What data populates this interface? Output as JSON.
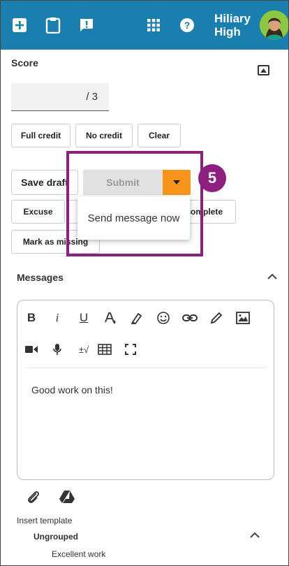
{
  "topbar": {
    "color": "#1a7fae",
    "icons": [
      "add-icon",
      "clipboard-icon",
      "feedback-icon",
      "apps-grid-icon",
      "help-icon"
    ],
    "user_name": "Hiliary High"
  },
  "score": {
    "label": "Score",
    "value": "",
    "suffix": "/ 3",
    "buttons": {
      "full_credit": "Full credit",
      "no_credit": "No credit",
      "clear": "Clear"
    }
  },
  "actions": {
    "save_draft": "Save draft",
    "submit": "Submit",
    "excuse": "Excuse",
    "complete_partial": "complete",
    "mark_missing": "Mark as missing"
  },
  "dropdown": {
    "send_now": "Send message now"
  },
  "callout": {
    "step": "5",
    "color": "#8c1f80"
  },
  "messages": {
    "label": "Messages",
    "editor_body": "Good work on this!",
    "toolbar_row1": [
      "bold-icon",
      "italic-icon",
      "underline-icon",
      "text-color-icon",
      "highlight-icon",
      "emoji-icon",
      "link-icon",
      "pencil-icon",
      "image-icon"
    ],
    "toolbar_row2": [
      "video-icon",
      "microphone-icon",
      "equation-icon",
      "table-icon",
      "fullscreen-icon"
    ],
    "row2_equation_text": "±√"
  },
  "template": {
    "insert_label": "Insert template",
    "group": "Ungrouped",
    "item": "Excellent work"
  },
  "colors": {
    "accent_orange": "#f7941d",
    "submit_disabled": "#e1e1e1"
  }
}
